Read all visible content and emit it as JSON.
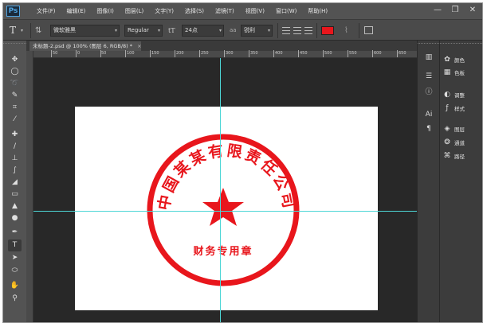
{
  "app": {
    "logo": "Ps"
  },
  "menu": [
    "文件(F)",
    "编辑(E)",
    "图像(I)",
    "图层(L)",
    "文字(Y)",
    "选择(S)",
    "滤镜(T)",
    "视图(V)",
    "窗口(W)",
    "帮助(H)"
  ],
  "window_controls": {
    "minimize": "—",
    "restore": "❐",
    "close": "✕"
  },
  "options_bar": {
    "tool_glyph": "T",
    "font_family": "微软雅黑",
    "font_style": "Regular",
    "font_size": "24点",
    "antialias_label": "aa",
    "antialias": "锐利",
    "text_color": "#e8161c"
  },
  "document_tab": {
    "title": "未标题-2.psd @ 100% (图层 6, RGB/8) *",
    "close": "×"
  },
  "ruler": {
    "labels": [
      "50",
      "0",
      "50",
      "100",
      "150",
      "200",
      "250",
      "300",
      "350",
      "400",
      "450",
      "500",
      "550",
      "600",
      "650"
    ]
  },
  "stamp": {
    "company": "中国某某有限责任公司",
    "department": "财务专用章",
    "color": "#e8161c"
  },
  "tools": [
    "move-icon",
    "marquee-icon",
    "lasso-icon",
    "quick-select-icon",
    "crop-icon",
    "eyedropper-icon",
    "healing-icon",
    "brush-icon",
    "clone-stamp-icon",
    "history-brush-icon",
    "eraser-icon",
    "gradient-icon",
    "blur-icon",
    "dodge-icon",
    "pen-icon",
    "type-icon",
    "path-select-icon",
    "shape-icon",
    "hand-icon",
    "zoom-icon"
  ],
  "mid_dock_labels": [
    "Ai",
    "¶"
  ],
  "panels": [
    {
      "icon": "color-panel-icon",
      "label": "颜色"
    },
    {
      "icon": "swatches-panel-icon",
      "label": "色板"
    },
    {
      "icon": "adjustments-panel-icon",
      "label": "调整"
    },
    {
      "icon": "styles-panel-icon",
      "label": "样式"
    },
    {
      "icon": "layers-panel-icon",
      "label": "图层"
    },
    {
      "icon": "channels-panel-icon",
      "label": "通道"
    },
    {
      "icon": "paths-panel-icon",
      "label": "路径"
    }
  ]
}
